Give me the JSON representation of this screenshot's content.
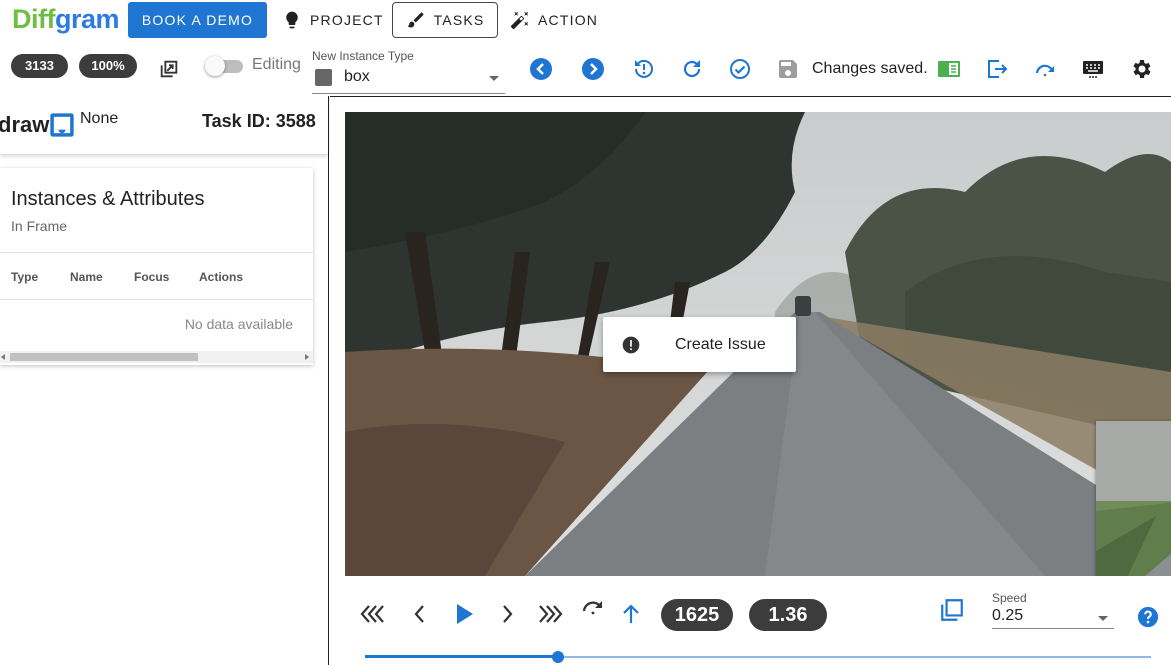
{
  "brand": {
    "logo_part1": "Diff",
    "logo_part2": "gram"
  },
  "nav": {
    "book_demo": "BOOK A DEMO",
    "project": "PROJECT",
    "tasks": "TASKS",
    "action": "ACTION"
  },
  "toolbar": {
    "count_pill": "3133",
    "zoom_pill": "100%",
    "editing_label": "Editing",
    "editing_on": false,
    "instance_type_label": "New Instance Type",
    "instance_type_value": "box",
    "saved_status": "Changes saved."
  },
  "left_panel": {
    "draw_label": "draw",
    "none_label": "None",
    "task_id": "Task ID: 3588",
    "instances_title": "Instances & Attributes",
    "instances_subtitle": "In Frame",
    "columns": [
      "Type",
      "Name",
      "Focus",
      "Actions"
    ],
    "empty_text": "No data available"
  },
  "canvas": {
    "context_menu_item": "Create Issue"
  },
  "playback": {
    "frame": "1625",
    "time": "1.36",
    "speed_label": "Speed",
    "speed_value": "0.25",
    "progress_fraction": 0.245
  },
  "colors": {
    "primary": "#1e76d2",
    "logo_green": "#6fbe44",
    "logo_blue": "#2c7be5",
    "pill_dark": "#3c3c3c",
    "annotation_green": "#4caf50"
  }
}
